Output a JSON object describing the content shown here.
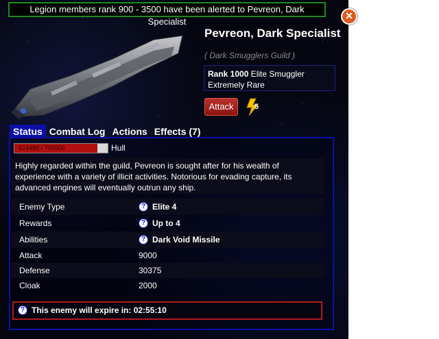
{
  "alert": {
    "text": "Legion members rank 900 - 3500 have been alerted to Pevreon, Dark Specialist"
  },
  "enemy": {
    "name": "Pevreon, Dark Specialist",
    "guild": "( Dark Smugglers Guild )",
    "rank_prefix": "Rank 1000",
    "rank_suffix": "Elite Smuggler",
    "rarity": "Extremely Rare"
  },
  "actions": {
    "attack_label": "Attack",
    "energy_cost": "5"
  },
  "tabs": [
    {
      "label": "Status",
      "active": true
    },
    {
      "label": "Combat Log",
      "active": false
    },
    {
      "label": "Actions",
      "active": false
    },
    {
      "label": "Effects (7)",
      "active": false
    }
  ],
  "hull": {
    "text": "624489 / 700000",
    "label": "Hull",
    "fraction": 0.892
  },
  "description": "Highly regarded within the guild, Pevreon is sought after for his wealth of experience with a variety of illicit activities. Notorious for evading capture, its advanced engines will eventually outrun any ship.",
  "stats": [
    {
      "label": "Enemy Type",
      "value": "Elite 4",
      "help": true
    },
    {
      "label": "Rewards",
      "value": "Up to 4",
      "help": true
    },
    {
      "label": "Abilities",
      "value": "Dark Void Missile",
      "help": true
    },
    {
      "label": "Attack",
      "value": "9000",
      "help": false
    },
    {
      "label": "Defense",
      "value": "30375",
      "help": false
    },
    {
      "label": "Cloak",
      "value": "2000",
      "help": false
    }
  ],
  "expire": {
    "text": "This enemy will expire in: 02:55:10"
  },
  "icons": {
    "close": "close-icon",
    "energy": "lightning-bolt-icon",
    "help": "question-mark-icon"
  },
  "colors": {
    "tab_active": "#0b0fa8",
    "alert_border": "#1e8a1e",
    "expire_border": "#b01c1c",
    "attack_button": "#a0221c",
    "hull_fill": "#b01010"
  }
}
